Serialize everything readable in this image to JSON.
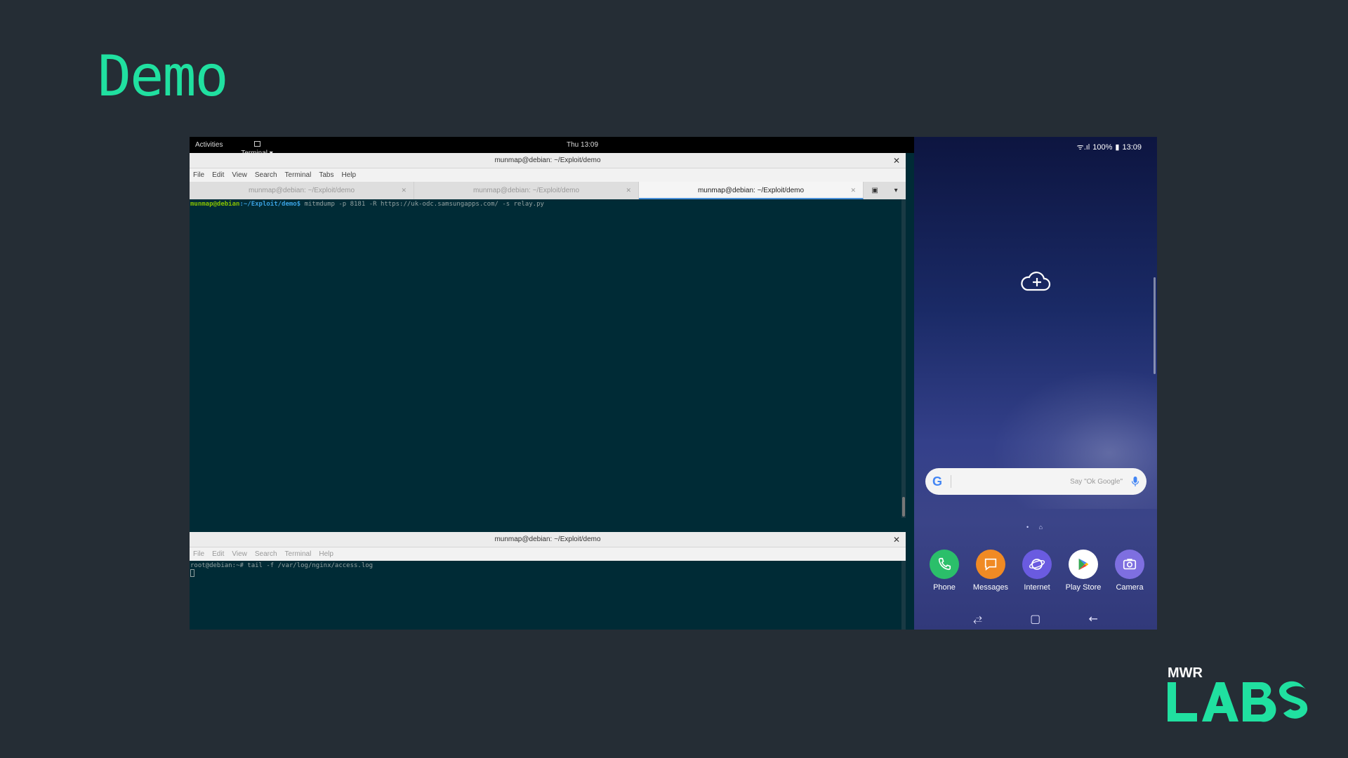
{
  "slide": {
    "title": "Demo",
    "logo_text": "MWR",
    "logo_mark": "LABS",
    "accent_color": "#20e0a0"
  },
  "desktop": {
    "topbar": {
      "activities": "Activities",
      "app_menu": "Terminal ▾",
      "clock": "Thu 13:09"
    },
    "window1": {
      "title": "munmap@debian: ~/Exploit/demo",
      "menu": [
        "File",
        "Edit",
        "View",
        "Search",
        "Terminal",
        "Tabs",
        "Help"
      ],
      "tabs": [
        {
          "label": "munmap@debian: ~/Exploit/demo",
          "active": false
        },
        {
          "label": "munmap@debian: ~/Exploit/demo",
          "active": false
        },
        {
          "label": "munmap@debian: ~/Exploit/demo",
          "active": true
        }
      ],
      "prompt_user": "munmap@debian",
      "prompt_path": ":~/Exploit/demo$",
      "command": " mitmdump -p 8181 -R https://uk-odc.samsungapps.com/ -s relay.py"
    },
    "window2": {
      "title": "munmap@debian: ~/Exploit/demo",
      "menu": [
        "File",
        "Edit",
        "View",
        "Search",
        "Terminal",
        "Help"
      ],
      "line": "root@debian:~# tail -f /var/log/nginx/access.log"
    }
  },
  "phone": {
    "status": {
      "signal": "ᯤ.ıl",
      "battery": "100%",
      "time": "13:09"
    },
    "search_hint": "Say \"Ok Google\"",
    "page_indicator": "• ⌂",
    "dock": [
      {
        "label": "Phone",
        "icon": "phone-icon",
        "color": "#2bbf6a"
      },
      {
        "label": "Messages",
        "icon": "messages-icon",
        "color": "#f08a24"
      },
      {
        "label": "Internet",
        "icon": "internet-icon",
        "color": "#6a5be0"
      },
      {
        "label": "Play Store",
        "icon": "play-store-icon",
        "color": "#ffffff"
      },
      {
        "label": "Camera",
        "icon": "camera-icon",
        "color": "#7e6fe0"
      }
    ],
    "nav": {
      "recents": "⥄",
      "home": "▢",
      "back": "←"
    }
  }
}
